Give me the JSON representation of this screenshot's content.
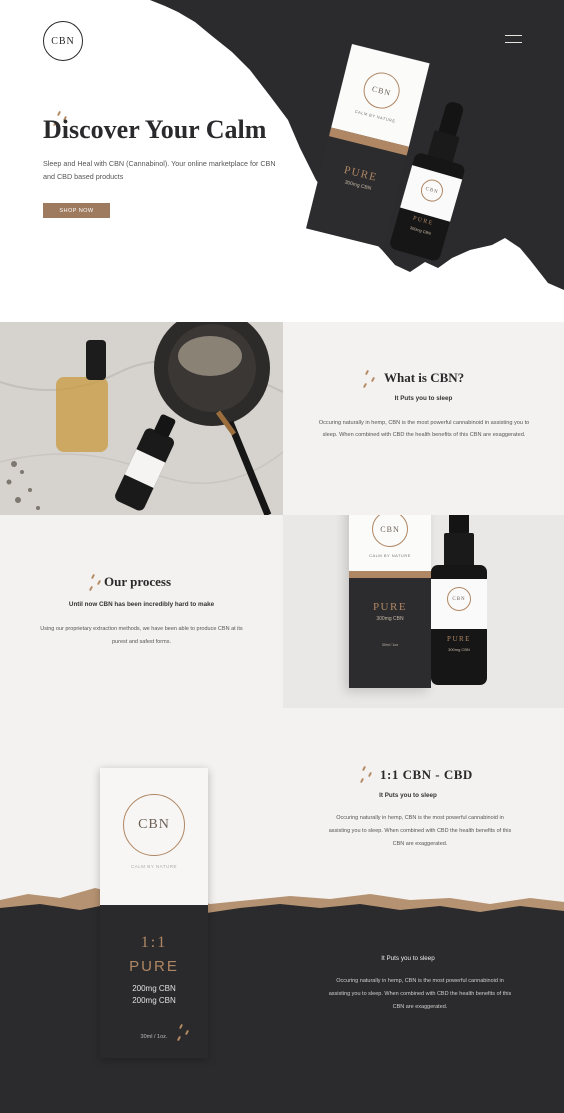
{
  "brand": {
    "logo_text": "CBN",
    "tagline": "CALM BY NATURE"
  },
  "colors": {
    "accent": "#9e7b5f",
    "dark": "#2a2a2c",
    "light": "#f3f2f0"
  },
  "header": {
    "menu_icon": "hamburger-icon"
  },
  "hero": {
    "title": "Discover Your Calm",
    "subtitle": "Sleep and Heal with CBN (Cannabinol). Your online marketplace for CBN and CBD based products",
    "cta_label": "SHOP NOW"
  },
  "product": {
    "name": "PURE",
    "dose": "300mg CBN",
    "size": "30ml / 1oz",
    "box_side_text": "CALM BY NATURE"
  },
  "what": {
    "title": "What is CBN?",
    "subtitle": "It Puts you to sleep",
    "body": "Occuring naturally in hemp, CBN is the most powerful cannabinoid in assisting you to sleep. When combined with CBD the health benefits of this CBN are exaggerated."
  },
  "process": {
    "title": "Our process",
    "subtitle": "Until now CBN has been incredibly hard to make",
    "body": "Using our proprietary extraction methods, we have been able to produce CBN at its purest and safest forms."
  },
  "ratio": {
    "title": "1:1 CBN - CBD",
    "subtitle": "It Puts you to sleep",
    "body": "Occuring naturally in hemp, CBN is the most powerful cannabinoid in assisting you to sleep. When combined with CBD the health benefits of this CBN are exaggerated."
  },
  "dark": {
    "subtitle": "It Puts you to sleep",
    "body": "Occuring naturally in hemp, CBN is the most powerful cannabinoid in assisting you to sleep. When combined with CBD the health benefits of this CBN are exaggerated."
  },
  "sachet": {
    "logo_text": "CBN",
    "tagline": "CALM BY NATURE",
    "ratio": "1:1",
    "name": "PURE",
    "line1": "200mg CBN",
    "line2": "200mg CBN",
    "size": "30ml / 1oz."
  }
}
